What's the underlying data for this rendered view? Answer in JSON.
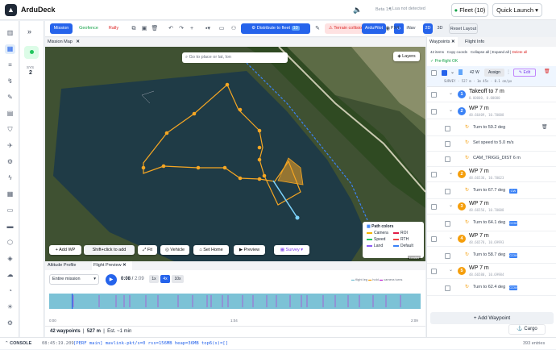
{
  "app": {
    "name": "ArduDeck",
    "beta": "Beta 1.1",
    "lua": "Lua not detected",
    "fleet": "Fleet (10)",
    "launch": "Quick Launch"
  },
  "tabs": {
    "mission": "Mission",
    "geofence": "Geofence",
    "rally": "Rally",
    "distribute": "Distribute to fleet",
    "distribute_count": "10",
    "terrain": "Terrain collision",
    "ardupilot": "ArduPilot",
    "px4": "PX4",
    "inav": "iNav",
    "twod": "2D",
    "threed": "3D",
    "reset": "Reset Layout"
  },
  "sys": {
    "label": "SYS",
    "num": "2"
  },
  "map": {
    "panel_title": "Mission Map",
    "search_placeholder": "Go to place or lat, lon",
    "layers": "Layers",
    "add_wp": "+ Add WP",
    "shift_hint": "Shift+click to add",
    "fit": "Fit",
    "vehicle": "Vehicle",
    "set_home": "Set Home",
    "preview": "Preview",
    "survey": "Survey",
    "leaflet": "Leaflet"
  },
  "legend": {
    "title": "Path colors",
    "items": [
      {
        "label": "Camera",
        "color": "#f5b400"
      },
      {
        "label": "ROI",
        "color": "#e11d48"
      },
      {
        "label": "Speed",
        "color": "#22c55e"
      },
      {
        "label": "RTH",
        "color": "#ef4444"
      },
      {
        "label": "Land",
        "color": "#8b5cf6"
      },
      {
        "label": "Default",
        "color": "#3b82f6"
      }
    ]
  },
  "bottom": {
    "tab1": "Altitude Profile",
    "tab2": "Flight Preview",
    "mode": "Entire mission",
    "time": "0:08",
    "total": "2:09",
    "speeds": [
      "1x",
      "4x",
      "10x"
    ],
    "legend_flight": "flight leg",
    "legend_hold": "hold",
    "legend_camera": "camera turns",
    "t_start": "0:00",
    "t_mid": "1:04",
    "t_end": "2:09",
    "waypoints": "42 waypoints",
    "distance": "527 m",
    "est": "Est. ~1 min",
    "progress": 0.062
  },
  "panel": {
    "tab1": "Waypoints",
    "tab2": "Flight Info",
    "count": "42 items",
    "copy": "Copy coords",
    "collapse": "Collapse all",
    "expand": "Expand all",
    "delete": "Delete all",
    "preflight": "Pre-flight OK",
    "sel_count": "42 W",
    "assign": "Assign",
    "edit": "Edit",
    "survey_meta": "SURVEY · 527 m · 1m 45s · 0.1 cm/px",
    "add_wp": "+ Add Waypoint",
    "cargo": "Cargo"
  },
  "rows": [
    {
      "type": "wp",
      "num": "1",
      "color": "#3b82f6",
      "title": "Takeoff to 7 m",
      "sub": "0.00000, 0.00000"
    },
    {
      "type": "wp",
      "num": "2",
      "color": "#3b82f6",
      "title": "WP 7 m",
      "sub": "48.66409, 10.70008"
    },
    {
      "type": "cmd",
      "title": "Turn to 59.2 deg"
    },
    {
      "type": "cmd",
      "title": "Set speed to 5.0 m/s"
    },
    {
      "type": "cmd",
      "title": "CAM_TRIGG_DIST 6 m"
    },
    {
      "type": "wp",
      "num": "2",
      "color": "#f59e0b",
      "title": "WP 7 m",
      "sub": "48.66536, 10.70023"
    },
    {
      "type": "cmd",
      "title": "Turn to 67.7 deg",
      "cw": "CW"
    },
    {
      "type": "wp",
      "num": "3",
      "color": "#f59e0b",
      "title": "WP 7 m",
      "sub": "48.66556, 10.70008"
    },
    {
      "type": "cmd",
      "title": "Turn to 64.1 deg",
      "cw": "CCW"
    },
    {
      "type": "wp",
      "num": "4",
      "color": "#f59e0b",
      "title": "WP 7 m",
      "sub": "48.66578, 10.69993"
    },
    {
      "type": "cmd",
      "title": "Turn to 58.7 deg",
      "cw": "CCW"
    },
    {
      "type": "wp",
      "num": "5",
      "color": "#f59e0b",
      "title": "WP 7 m",
      "sub": "48.66580, 10.69984"
    },
    {
      "type": "cmd",
      "title": "Turn to 62.4 deg",
      "cw": "CCW"
    }
  ],
  "status": {
    "label": "CONSOLE",
    "time": "08:45:19.209",
    "text": "[PERF main] mavlink-pkt/s=0 rss=156MB heap=36MB top6(s)=[]",
    "entries": "393 entries"
  }
}
